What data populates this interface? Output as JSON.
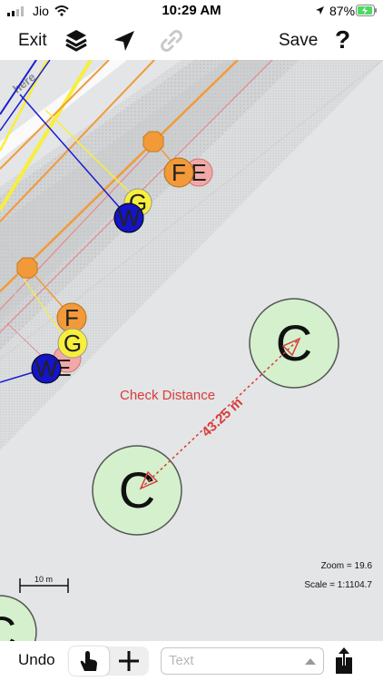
{
  "status_bar": {
    "carrier": "Jio",
    "time": "10:29 AM",
    "battery": "87%"
  },
  "toolbar": {
    "exit_label": "Exit",
    "save_label": "Save",
    "help_label": "?",
    "icons": [
      "layers-icon",
      "location-arrow-icon",
      "link-icon"
    ]
  },
  "map": {
    "street_label": "here",
    "nodes": [
      {
        "letter": "F"
      },
      {
        "letter": "E"
      },
      {
        "letter": "G"
      },
      {
        "letter": "W"
      },
      {
        "letter": "F"
      },
      {
        "letter": "G"
      },
      {
        "letter": "E"
      },
      {
        "letter": "W"
      }
    ],
    "circles": [
      {
        "letter": "C"
      },
      {
        "letter": "C"
      }
    ],
    "measure": {
      "title": "Check Distance",
      "distance": "43.25 m"
    },
    "scale_bar_label": "10 m",
    "zoom_text": "Zoom = 19.6",
    "scale_text": "Scale = 1:1104.7"
  },
  "bottom_bar": {
    "undo_label": "Undo",
    "text_placeholder": "Text",
    "icons": [
      "hand-pointer-icon",
      "plus-icon",
      "share-icon"
    ]
  },
  "colors": {
    "measure_red": "#d93b3b",
    "circle_fill": "#d4f0cc",
    "node_orange": "#f0a04b",
    "node_pink": "#f0a6a6",
    "node_yellow": "#f5e94a",
    "node_blue": "#1919c8"
  }
}
